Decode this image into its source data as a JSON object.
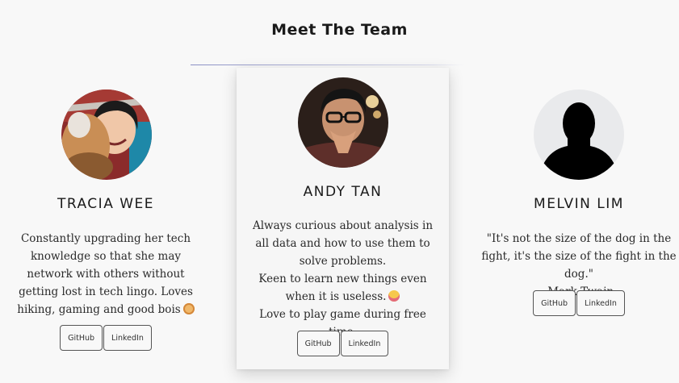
{
  "header": {
    "title": "Meet The Team"
  },
  "members": [
    {
      "name": "TRACIA WEE",
      "description": [
        "Constantly upgrading her tech knowledge so that she may network with others without getting lost in tech lingo. Loves hiking, gaming and good bois"
      ],
      "emoji": "dog-face-emoji-icon",
      "github_label": "GitHub",
      "linkedin_label": "LinkedIn"
    },
    {
      "name": "ANDY TAN",
      "description": [
        "Always curious about analysis in all data and how to use them to solve problems.",
        "Keen to learn new things even when it is useless.",
        "Love to play game during free time."
      ],
      "emoji": "crying-face-emoji-icon",
      "github_label": "GitHub",
      "linkedin_label": "LinkedIn"
    },
    {
      "name": "MELVIN LIM",
      "description": [
        "\"It's not the size of the dog in the fight, it's the size of the fight in the dog.\"",
        "-Mark Twain"
      ],
      "github_label": "GitHub",
      "linkedin_label": "LinkedIn"
    }
  ],
  "colors": {
    "background": "#f8f8f8",
    "divider": "#8a8fc4",
    "text": "#222222"
  }
}
